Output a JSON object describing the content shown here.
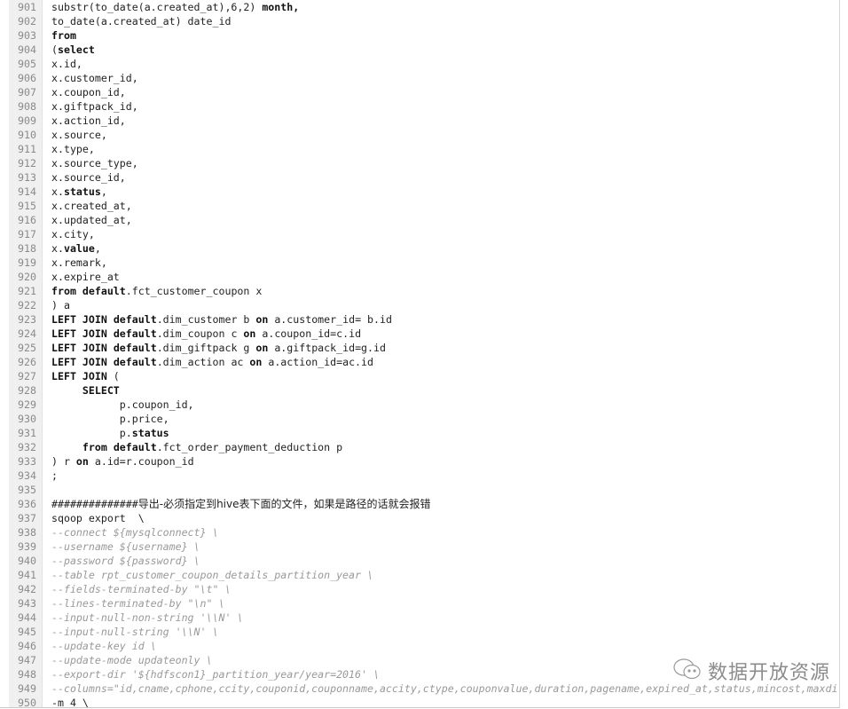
{
  "editor": {
    "lines": [
      {
        "n": "901",
        "segs": [
          {
            "t": "substr(to_date(a.created_at),6,2) "
          },
          {
            "t": "month,",
            "s": "kw"
          }
        ]
      },
      {
        "n": "902",
        "segs": [
          {
            "t": "to_date(a.created_at) date_id"
          }
        ]
      },
      {
        "n": "903",
        "segs": [
          {
            "t": "from",
            "s": "kw"
          }
        ]
      },
      {
        "n": "904",
        "segs": [
          {
            "t": "("
          },
          {
            "t": "select",
            "s": "kw"
          }
        ]
      },
      {
        "n": "905",
        "segs": [
          {
            "t": "x.id,"
          }
        ]
      },
      {
        "n": "906",
        "segs": [
          {
            "t": "x.customer_id,"
          }
        ]
      },
      {
        "n": "907",
        "segs": [
          {
            "t": "x.coupon_id,"
          }
        ]
      },
      {
        "n": "908",
        "segs": [
          {
            "t": "x.giftpack_id,"
          }
        ]
      },
      {
        "n": "909",
        "segs": [
          {
            "t": "x.action_id,"
          }
        ]
      },
      {
        "n": "910",
        "segs": [
          {
            "t": "x.source,"
          }
        ]
      },
      {
        "n": "911",
        "segs": [
          {
            "t": "x.type,"
          }
        ]
      },
      {
        "n": "912",
        "segs": [
          {
            "t": "x.source_type,"
          }
        ]
      },
      {
        "n": "913",
        "segs": [
          {
            "t": "x.source_id,"
          }
        ]
      },
      {
        "n": "914",
        "segs": [
          {
            "t": "x."
          },
          {
            "t": "status",
            "s": "kw"
          },
          {
            "t": ","
          }
        ]
      },
      {
        "n": "915",
        "segs": [
          {
            "t": "x.created_at,"
          }
        ]
      },
      {
        "n": "916",
        "segs": [
          {
            "t": "x.updated_at,"
          }
        ]
      },
      {
        "n": "917",
        "segs": [
          {
            "t": "x.city,"
          }
        ]
      },
      {
        "n": "918",
        "segs": [
          {
            "t": "x."
          },
          {
            "t": "value",
            "s": "kw"
          },
          {
            "t": ","
          }
        ]
      },
      {
        "n": "919",
        "segs": [
          {
            "t": "x.remark,"
          }
        ]
      },
      {
        "n": "920",
        "segs": [
          {
            "t": "x.expire_at"
          }
        ]
      },
      {
        "n": "921",
        "segs": [
          {
            "t": "from",
            "s": "kw"
          },
          {
            "t": " "
          },
          {
            "t": "default",
            "s": "kw"
          },
          {
            "t": ".fct_customer_coupon x"
          }
        ]
      },
      {
        "n": "922",
        "segs": [
          {
            "t": ") a"
          }
        ]
      },
      {
        "n": "923",
        "segs": [
          {
            "t": "LEFT JOIN",
            "s": "kw"
          },
          {
            "t": " "
          },
          {
            "t": "default",
            "s": "kw"
          },
          {
            "t": ".dim_customer b "
          },
          {
            "t": "on",
            "s": "kw"
          },
          {
            "t": " a.customer_id= b.id"
          }
        ]
      },
      {
        "n": "924",
        "segs": [
          {
            "t": "LEFT JOIN",
            "s": "kw"
          },
          {
            "t": " "
          },
          {
            "t": "default",
            "s": "kw"
          },
          {
            "t": ".dim_coupon c "
          },
          {
            "t": "on",
            "s": "kw"
          },
          {
            "t": " a.coupon_id=c.id"
          }
        ]
      },
      {
        "n": "925",
        "segs": [
          {
            "t": "LEFT JOIN",
            "s": "kw"
          },
          {
            "t": " "
          },
          {
            "t": "default",
            "s": "kw"
          },
          {
            "t": ".dim_giftpack g "
          },
          {
            "t": "on",
            "s": "kw"
          },
          {
            "t": " a.giftpack_id=g.id"
          }
        ]
      },
      {
        "n": "926",
        "segs": [
          {
            "t": "LEFT JOIN",
            "s": "kw"
          },
          {
            "t": " "
          },
          {
            "t": "default",
            "s": "kw"
          },
          {
            "t": ".dim_action ac "
          },
          {
            "t": "on",
            "s": "kw"
          },
          {
            "t": " a.action_id=ac.id"
          }
        ]
      },
      {
        "n": "927",
        "segs": [
          {
            "t": "LEFT JOIN",
            "s": "kw"
          },
          {
            "t": " ("
          }
        ]
      },
      {
        "n": "928",
        "segs": [
          {
            "t": "     "
          },
          {
            "t": "SELECT",
            "s": "kw"
          }
        ]
      },
      {
        "n": "929",
        "segs": [
          {
            "t": "           p.coupon_id,"
          }
        ]
      },
      {
        "n": "930",
        "segs": [
          {
            "t": "           p.price,"
          }
        ]
      },
      {
        "n": "931",
        "segs": [
          {
            "t": "           p."
          },
          {
            "t": "status",
            "s": "kw"
          }
        ]
      },
      {
        "n": "932",
        "segs": [
          {
            "t": "     "
          },
          {
            "t": "from",
            "s": "kw"
          },
          {
            "t": " "
          },
          {
            "t": "default",
            "s": "kw"
          },
          {
            "t": ".fct_order_payment_deduction p"
          }
        ]
      },
      {
        "n": "933",
        "segs": [
          {
            "t": ") r "
          },
          {
            "t": "on",
            "s": "kw"
          },
          {
            "t": " a.id=r.coupon_id"
          }
        ]
      },
      {
        "n": "934",
        "segs": [
          {
            "t": ";"
          }
        ]
      },
      {
        "n": "935",
        "segs": []
      },
      {
        "n": "936",
        "segs": [
          {
            "t": "##############"
          },
          {
            "t": "导出-必须指定到hive表下面的文件，如果是路径的话就会报错",
            "s": "zh"
          }
        ]
      },
      {
        "n": "937",
        "segs": [
          {
            "t": "sqoop export  \\"
          }
        ]
      },
      {
        "n": "938",
        "segs": [
          {
            "t": "--connect ${mysqlconnect} \\",
            "s": "cm"
          }
        ]
      },
      {
        "n": "939",
        "segs": [
          {
            "t": "--username ${username} \\",
            "s": "cm"
          }
        ]
      },
      {
        "n": "940",
        "segs": [
          {
            "t": "--password ${password} \\",
            "s": "cm"
          }
        ]
      },
      {
        "n": "941",
        "segs": [
          {
            "t": "--table rpt_customer_coupon_details_partition_year \\",
            "s": "cm"
          }
        ]
      },
      {
        "n": "942",
        "segs": [
          {
            "t": "--fields-terminated-by \"\\t\" \\",
            "s": "cm"
          }
        ]
      },
      {
        "n": "943",
        "segs": [
          {
            "t": "--lines-terminated-by \"\\n\" \\",
            "s": "cm"
          }
        ]
      },
      {
        "n": "944",
        "segs": [
          {
            "t": "--input-null-non-string '\\\\N' \\",
            "s": "cm"
          }
        ]
      },
      {
        "n": "945",
        "segs": [
          {
            "t": "--input-null-string '\\\\N' \\",
            "s": "cm"
          }
        ]
      },
      {
        "n": "946",
        "segs": [
          {
            "t": "--update-key id \\",
            "s": "cm"
          }
        ]
      },
      {
        "n": "947",
        "segs": [
          {
            "t": "--update-mode updateonly \\",
            "s": "cm"
          }
        ]
      },
      {
        "n": "948",
        "segs": [
          {
            "t": "--export-dir '${hdfscon1}_partition_year/year=2016' \\",
            "s": "cm"
          }
        ]
      },
      {
        "n": "949",
        "segs": [
          {
            "t": "--columns=\"id,cname,cphone,ccity,couponid,couponname,accity,ctype,couponvalue,duration,pagename,expired_at,status,mincost,maxdi",
            "s": "cm"
          }
        ]
      },
      {
        "n": "950",
        "segs": [
          {
            "t": "-m 4 \\"
          }
        ]
      }
    ]
  },
  "watermark": {
    "icon": "wechat-icon",
    "text": "数据开放资源"
  }
}
